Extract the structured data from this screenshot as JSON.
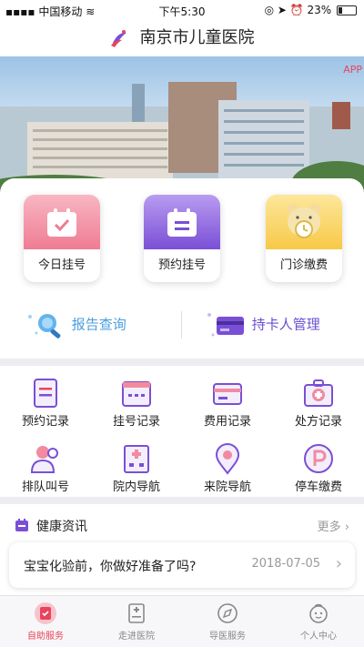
{
  "status_bar": {
    "carrier": "中国移动",
    "time": "下午5:30",
    "battery": "23%"
  },
  "header": {
    "title": "南京市儿童医院"
  },
  "banner": {
    "corner_text": "APP"
  },
  "main_tiles": [
    {
      "label": "今日挂号",
      "icon": "calendar-check-icon"
    },
    {
      "label": "预约挂号",
      "icon": "calendar-list-icon"
    },
    {
      "label": "门诊缴费",
      "icon": "bear-clock-icon"
    }
  ],
  "quick_links": [
    {
      "label": "报告查询",
      "icon": "search-icon",
      "color": "#4a9ee0"
    },
    {
      "label": "持卡人管理",
      "icon": "card-icon",
      "color": "#6a4fd2"
    }
  ],
  "services": [
    {
      "label": "预约记录",
      "icon": "document-icon"
    },
    {
      "label": "挂号记录",
      "icon": "calendar-icon"
    },
    {
      "label": "费用记录",
      "icon": "receipt-icon"
    },
    {
      "label": "处方记录",
      "icon": "medical-kit-icon"
    },
    {
      "label": "排队叫号",
      "icon": "people-icon"
    },
    {
      "label": "院内导航",
      "icon": "hospital-icon"
    },
    {
      "label": "来院导航",
      "icon": "location-pin-icon"
    },
    {
      "label": "停车缴费",
      "icon": "parking-icon"
    }
  ],
  "news": {
    "section_title": "健康资讯",
    "more_label": "更多",
    "item_title": "宝宝化验前，你做好准备了吗?",
    "item_date": "2018-07-05"
  },
  "tabs": [
    {
      "label": "自助服务",
      "active": true
    },
    {
      "label": "走进医院",
      "active": false
    },
    {
      "label": "导医服务",
      "active": false
    },
    {
      "label": "个人中心",
      "active": false
    }
  ],
  "colors": {
    "accent": "#e9445b",
    "purple": "#7a4fd6",
    "blue": "#4a9ee0"
  }
}
